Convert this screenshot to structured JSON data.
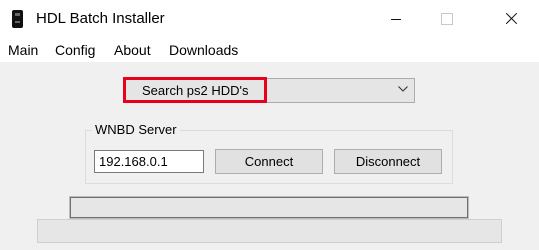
{
  "window": {
    "title": "HDL Batch Installer",
    "icon": "ps2-console-icon",
    "controls": [
      "minimize-icon",
      "maximize-icon",
      "close-icon"
    ]
  },
  "menu": {
    "items": [
      "Main",
      "Config",
      "About",
      "Downloads"
    ]
  },
  "search": {
    "selected_value": "Search ps2 HDD's",
    "highlight_color": "#e8001c"
  },
  "wnbd": {
    "group_label": "WNBD Server",
    "ip_value": "192.168.0.1",
    "connect_label": "Connect",
    "disconnect_label": "Disconnect"
  },
  "progress": {
    "value": 0
  }
}
